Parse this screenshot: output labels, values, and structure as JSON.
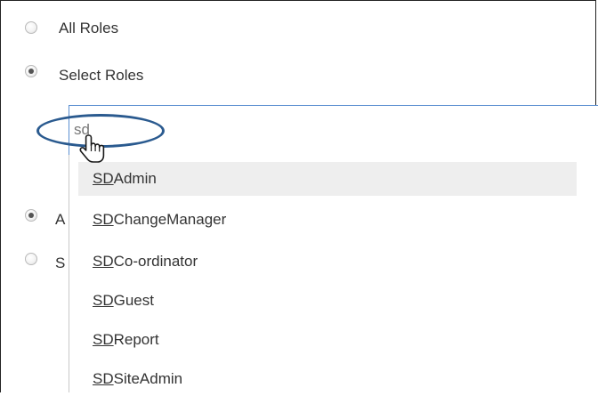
{
  "role_options": {
    "all_roles": {
      "label": "All Roles",
      "selected": false
    },
    "select_roles": {
      "label": "Select Roles",
      "selected": true
    },
    "third_option": {
      "label": "A",
      "selected": true
    },
    "fourth_option": {
      "label": "S",
      "selected": false
    }
  },
  "role_search": {
    "value": "sd"
  },
  "suggestions": [
    {
      "prefix": "SD",
      "rest": "Admin"
    },
    {
      "prefix": "SD",
      "rest": "ChangeManager"
    },
    {
      "prefix": "SD",
      "rest": "Co-ordinator"
    },
    {
      "prefix": "SD",
      "rest": "Guest"
    },
    {
      "prefix": "SD",
      "rest": "Report"
    },
    {
      "prefix": "SD",
      "rest": "SiteAdmin"
    }
  ],
  "highlight_color": "#eeeeee",
  "input_border_color": "#5b8fd1",
  "annotation_color": "#2a5a8f"
}
